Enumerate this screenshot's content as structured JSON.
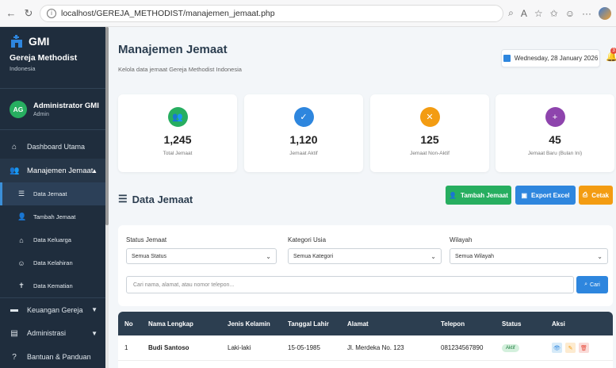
{
  "browser": {
    "url": "localhost/GEREJA_METHODIST/manajemen_jemaat.php"
  },
  "sidebar": {
    "brand": "GMI",
    "church_name": "Gereja Methodist",
    "country": "Indonesia",
    "user_initials": "AG",
    "user_name": "Administrator GMI",
    "user_role": "Admin",
    "menu": [
      {
        "label": "Dashboard Utama",
        "icon": "home-icon"
      },
      {
        "label": "Manajemen Jemaat",
        "icon": "users-icon"
      },
      {
        "label": "Keuangan Gereja",
        "icon": "wallet-icon"
      },
      {
        "label": "Administrasi",
        "icon": "document-icon"
      },
      {
        "label": "Bantuan & Panduan",
        "icon": "help-icon"
      }
    ],
    "submenu": [
      {
        "label": "Data Jemaat",
        "icon": "list-icon"
      },
      {
        "label": "Tambah Jemaat",
        "icon": "user-plus-icon"
      },
      {
        "label": "Data Keluarga",
        "icon": "home-icon"
      },
      {
        "label": "Data Kelahiran",
        "icon": "baby-icon"
      },
      {
        "label": "Data Kematian",
        "icon": "cross-icon"
      }
    ]
  },
  "header": {
    "title": "Manajemen Jemaat",
    "subtitle": "Kelola data jemaat Gereja Methodist Indonesia",
    "date": "Wednesday, 28 January 2026",
    "notification_count": "3"
  },
  "stats": [
    {
      "value": "1,245",
      "label": "Total Jemaat",
      "color": "#27ae60"
    },
    {
      "value": "1,120",
      "label": "Jemaat Aktif",
      "color": "#2e86de"
    },
    {
      "value": "125",
      "label": "Jemaat Non-Aktif",
      "color": "#f39c12"
    },
    {
      "value": "45",
      "label": "Jemaat Baru (Bulan Ini)",
      "color": "#8e44ad"
    }
  ],
  "section": {
    "title": "Data Jemaat",
    "add_label": "Tambah Jemaat",
    "export_label": "Export Excel",
    "print_label": "Cetak"
  },
  "filters": {
    "status_label": "Status Jemaat",
    "status_value": "Semua Status",
    "age_label": "Kategori Usia",
    "age_value": "Semua Kategori",
    "region_label": "Wilayah",
    "region_value": "Semua Wilayah",
    "search_placeholder": "Cari nama, alamat, atau nomor telepon...",
    "search_button": "Cari"
  },
  "table": {
    "columns": [
      "No",
      "Nama Lengkap",
      "Jenis Kelamin",
      "Tanggal Lahir",
      "Alamat",
      "Telepon",
      "Status",
      "Aksi"
    ],
    "rows": [
      [
        "1",
        "Budi Santoso",
        "Laki-laki",
        "15-05-1985",
        "Jl. Merdeka No. 123",
        "081234567890",
        "Aktif"
      ]
    ]
  }
}
